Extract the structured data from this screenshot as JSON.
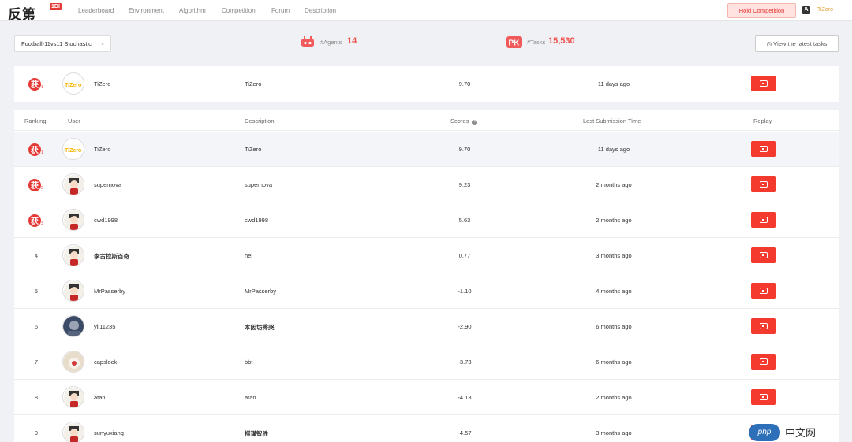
{
  "nav": {
    "logo_text": "反第",
    "logo_badge": "1DI",
    "links": [
      "Leaderboard",
      "Environment",
      "Algorithm",
      "Competition",
      "Forum",
      "Description"
    ],
    "hold_button": "Hold Competition",
    "lang_icon": "A",
    "user_name": "TiZero"
  },
  "toolbar": {
    "env_select": "Football-11vs11 Stochastic",
    "agents_label": "#Agents",
    "agents_value": "14",
    "tasks_label": "#Tasks",
    "tasks_value": "15,530",
    "latest_tasks_button": "View the latest tasks"
  },
  "top_entry": {
    "user": "TiZero",
    "description": "TiZero",
    "score": "9.70",
    "time": "11 days ago"
  },
  "table": {
    "headers": {
      "ranking": "Ranking",
      "user": "User",
      "description": "Description",
      "scores": "Scores",
      "last_submission": "Last Submission Time",
      "replay": "Replay"
    },
    "rows": [
      {
        "rank": "1",
        "user": "TiZero",
        "description": "TiZero",
        "score": "9.70",
        "time": "11 days ago",
        "avatar": "tizero-logo"
      },
      {
        "rank": "2",
        "user": "supernova",
        "description": "supernova",
        "score": "9.23",
        "time": "2 months ago",
        "avatar": "character"
      },
      {
        "rank": "3",
        "user": "cwd1998",
        "description": "cwd1998",
        "score": "5.63",
        "time": "2 months ago",
        "avatar": "character"
      },
      {
        "rank": "4",
        "user": "李古拉斯百奇",
        "description": "hei",
        "score": "0.77",
        "time": "3 months ago",
        "avatar": "character"
      },
      {
        "rank": "5",
        "user": "MrPasserby",
        "description": "MrPasserby",
        "score": "-1.10",
        "time": "4 months ago",
        "avatar": "character"
      },
      {
        "rank": "6",
        "user": "yll11235",
        "description": "本因坊秀哭",
        "score": "-2.90",
        "time": "6 months ago",
        "avatar": "photo"
      },
      {
        "rank": "7",
        "user": "capslock",
        "description": "bbt",
        "score": "-3.73",
        "time": "6 months ago",
        "avatar": "cat"
      },
      {
        "rank": "8",
        "user": "atan",
        "description": "atan",
        "score": "-4.13",
        "time": "2 months ago",
        "avatar": "character"
      },
      {
        "rank": "9",
        "user": "sunyuxiang",
        "description": "棋谋智胜",
        "score": "-4.57",
        "time": "3 months ago",
        "avatar": "character"
      }
    ]
  },
  "medal_text": "获",
  "watermark": {
    "logo": "php",
    "text": "中文网"
  },
  "colors": {
    "accent": "#f43a2f",
    "value": "#ef5350",
    "hold_bg": "#ffe3e0"
  }
}
